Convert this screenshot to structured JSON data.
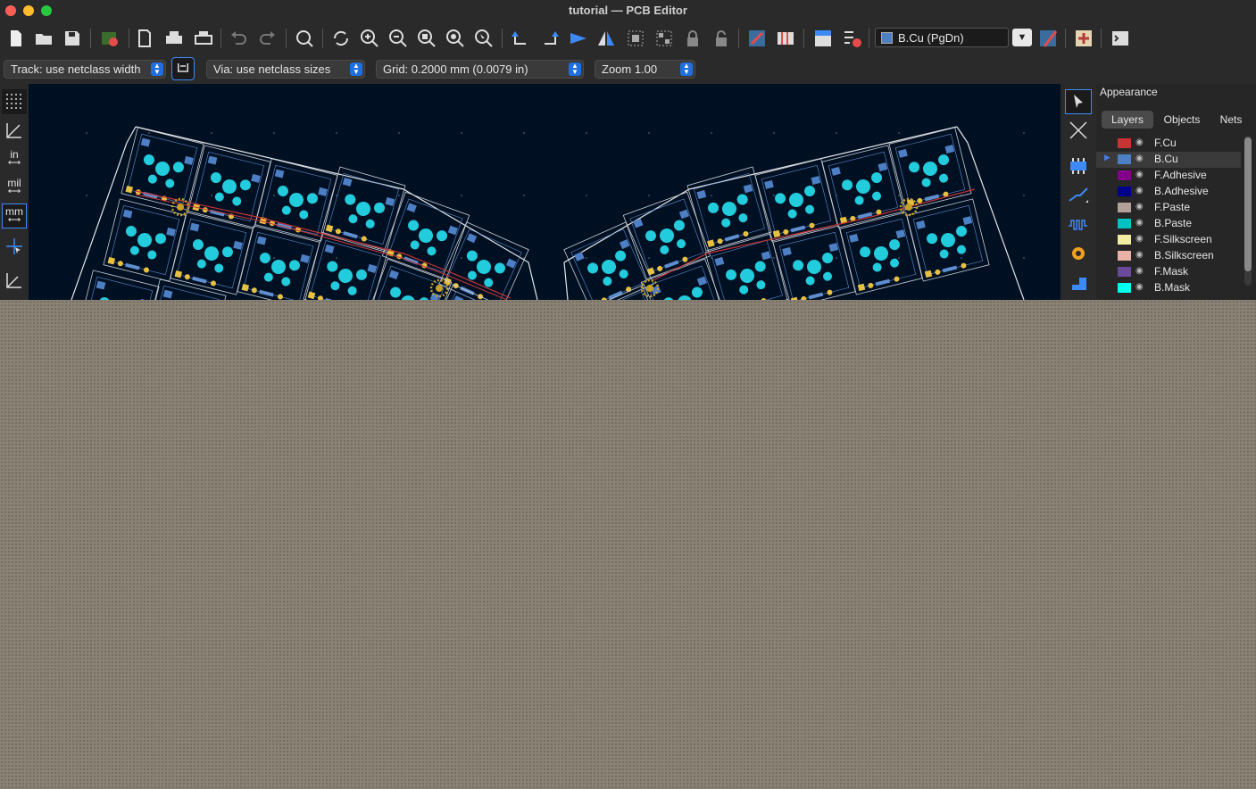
{
  "window": {
    "title": "tutorial — PCB Editor"
  },
  "toolbar": {
    "icons": [
      "new-board-icon",
      "open-icon",
      "save-icon",
      "board-setup-icon",
      "page-settings-icon",
      "print-icon",
      "plot-icon",
      "undo-icon",
      "redo-icon",
      "find-icon",
      "redraw-icon",
      "zoom-in-icon",
      "zoom-out-icon",
      "zoom-fit-icon",
      "zoom-objects-icon",
      "zoom-selection-icon",
      "rotate-ccw-icon",
      "rotate-cw-icon",
      "flip-icon",
      "mirror-icon",
      "group-icon",
      "ungroup-icon",
      "lock-icon",
      "unlock-icon",
      "update-pcb-icon",
      "footprint-editor-icon",
      "netlist-icon",
      "drc-icon",
      "layer-pair-icon",
      "scripting-icon",
      "terminal-icon"
    ],
    "active_layer": "B.Cu (PgDn)",
    "active_layer_color": "#4d7fc4"
  },
  "options_bar": {
    "track": "Track: use netclass width",
    "via": "Via: use netclass sizes",
    "grid": "Grid: 0.2000 mm (0.0079 in)",
    "zoom": "Zoom 1.00"
  },
  "left_toolbar": {
    "unit_in": "in",
    "unit_mil": "mil",
    "unit_mm": "mm",
    "active_unit": "mm"
  },
  "appearance": {
    "title": "Appearance",
    "tabs": [
      "Layers",
      "Objects",
      "Nets"
    ],
    "active_tab": "Layers",
    "layers": [
      {
        "name": "F.Cu",
        "color": "#c83434"
      },
      {
        "name": "B.Cu",
        "color": "#4d7fc4",
        "active": true
      },
      {
        "name": "F.Adhesive",
        "color": "#84008a"
      },
      {
        "name": "B.Adhesive",
        "color": "#00008b"
      },
      {
        "name": "F.Paste",
        "color": "#b4a09a"
      },
      {
        "name": "B.Paste",
        "color": "#00c2c2"
      },
      {
        "name": "F.Silkscreen",
        "color": "#f2eda1"
      },
      {
        "name": "B.Silkscreen",
        "color": "#e8b2a7"
      },
      {
        "name": "F.Mask",
        "color": "#6b4a9c"
      },
      {
        "name": "B.Mask",
        "color": "#02ffee"
      }
    ]
  },
  "colors": {
    "canvas": "#001023",
    "pad": "#22ccdd",
    "smd_pad": "#4d7fc4",
    "via": "#c8a028",
    "track": "#c83434",
    "outline": "#e6e6e6",
    "accent": "#1f6fe0"
  }
}
